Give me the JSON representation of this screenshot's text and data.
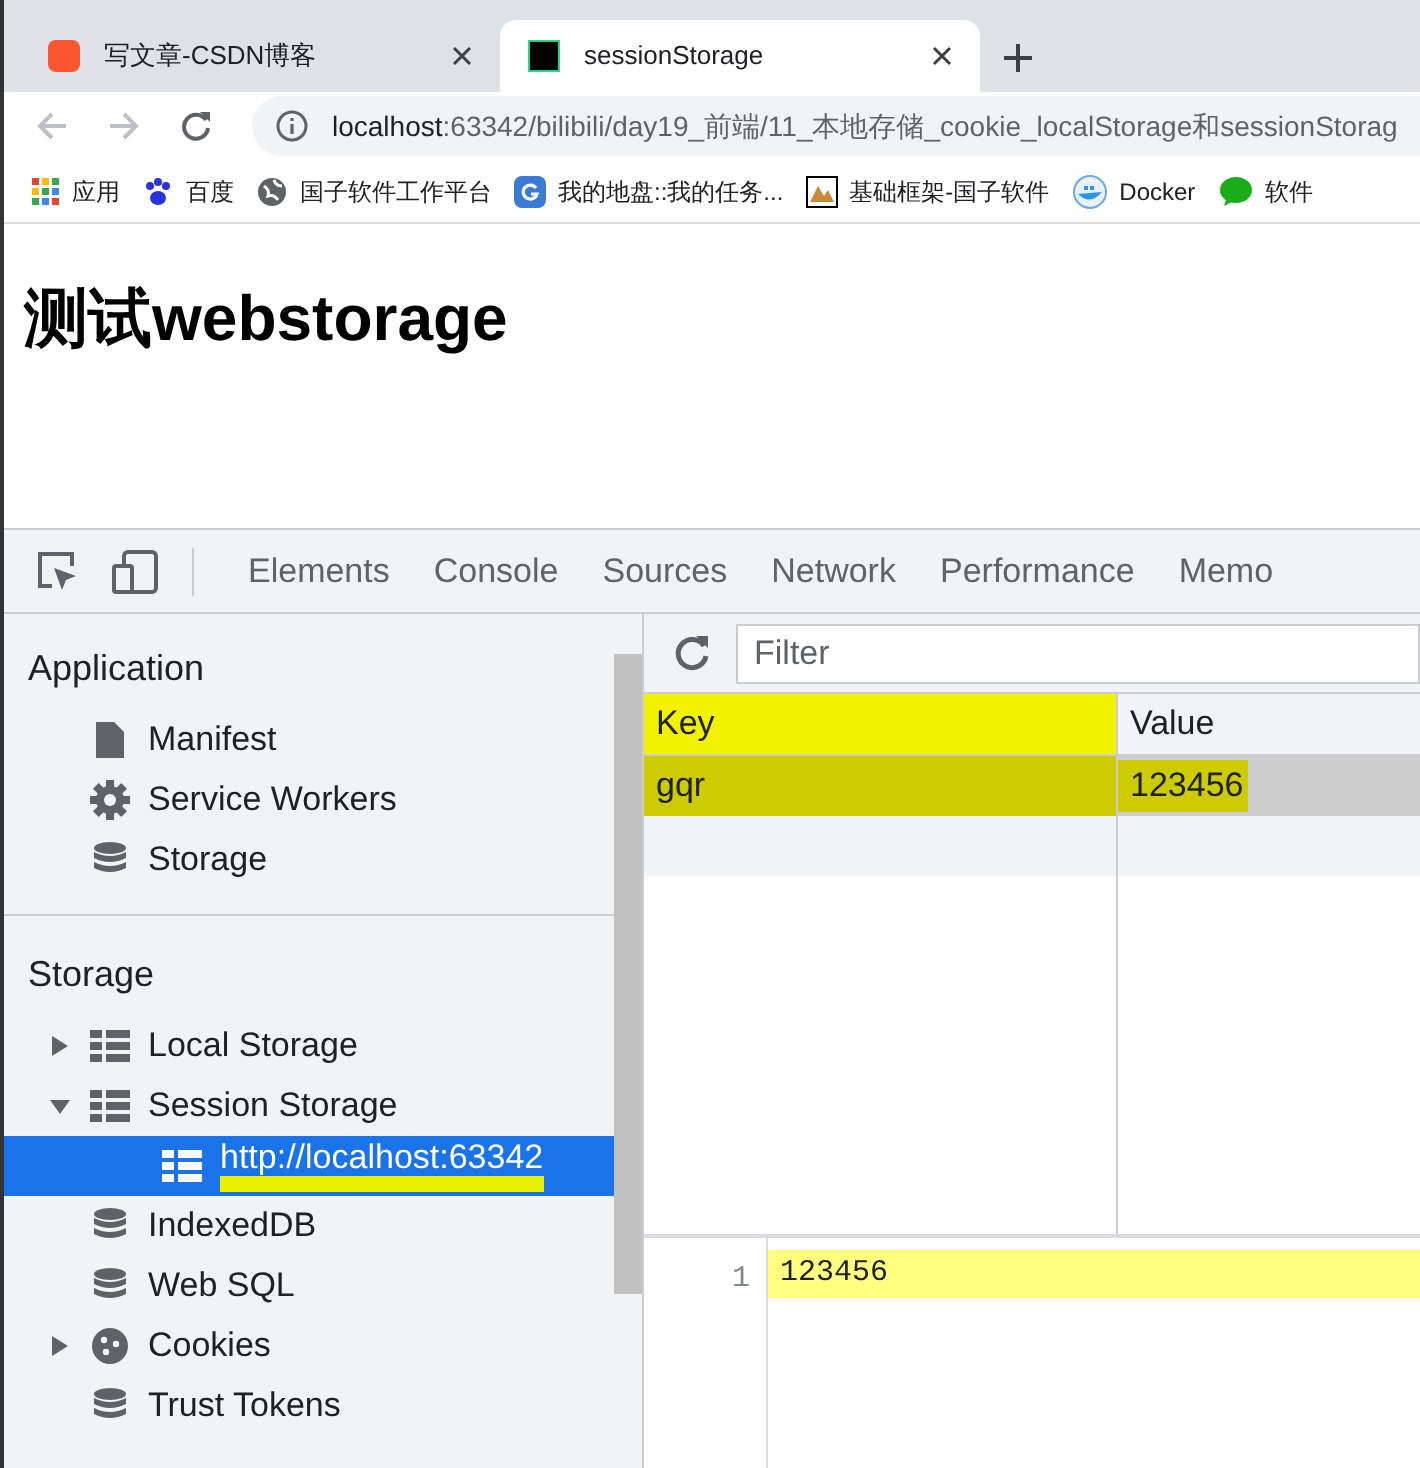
{
  "browser_tabs": [
    {
      "title": "写文章-CSDN博客",
      "selected": false,
      "kind": "csdn"
    },
    {
      "title": "sessionStorage",
      "selected": true,
      "kind": "pc"
    }
  ],
  "address_bar": {
    "host": "localhost",
    "path": ":63342/bilibili/day19_前端/11_本地存储_cookie_localStorage和sessionStorag"
  },
  "bookmarks": [
    {
      "label": "应用",
      "kind": "apps"
    },
    {
      "label": "百度",
      "kind": "paw"
    },
    {
      "label": "国子软件工作平台",
      "kind": "globe"
    },
    {
      "label": "我的地盘::我的任务...",
      "kind": "g"
    },
    {
      "label": "基础框架-国子软件",
      "kind": "image"
    },
    {
      "label": "Docker",
      "kind": "whale"
    },
    {
      "label": "软件",
      "kind": "chat"
    }
  ],
  "page": {
    "heading": "测试webstorage"
  },
  "devtools_tabs": [
    "Elements",
    "Console",
    "Sources",
    "Network",
    "Performance",
    "Memo"
  ],
  "sidebar": {
    "sections": [
      {
        "title": "Application",
        "items": [
          {
            "label": "Manifest",
            "kind": "file",
            "selected": false
          },
          {
            "label": "Service Workers",
            "kind": "gear",
            "selected": false
          },
          {
            "label": "Storage",
            "kind": "database",
            "selected": false
          }
        ]
      },
      {
        "title": "Storage",
        "items": [
          {
            "label": "Local Storage",
            "kind": "table",
            "expanded": false,
            "selected": false
          },
          {
            "label": "Session Storage",
            "kind": "table",
            "expanded": true,
            "selected": false,
            "children": [
              {
                "label": "http://localhost:63342",
                "kind": "table",
                "selected": true,
                "highlighted": true
              }
            ]
          },
          {
            "label": "IndexedDB",
            "kind": "database",
            "selected": false
          },
          {
            "label": "Web SQL",
            "kind": "database",
            "selected": false
          },
          {
            "label": "Cookies",
            "kind": "cookie",
            "expanded": false,
            "selected": false
          },
          {
            "label": "Trust Tokens",
            "kind": "database",
            "selected": false
          }
        ]
      }
    ]
  },
  "filter": {
    "placeholder": "Filter"
  },
  "table": {
    "columns": [
      {
        "label": "Key",
        "highlighted": true
      },
      {
        "label": "Value",
        "highlighted": false
      }
    ],
    "rows": [
      {
        "key": "gqr",
        "value": "123456",
        "selected": true,
        "highlighted": true
      }
    ]
  },
  "preview": {
    "line_number": "1",
    "text": "123456"
  }
}
